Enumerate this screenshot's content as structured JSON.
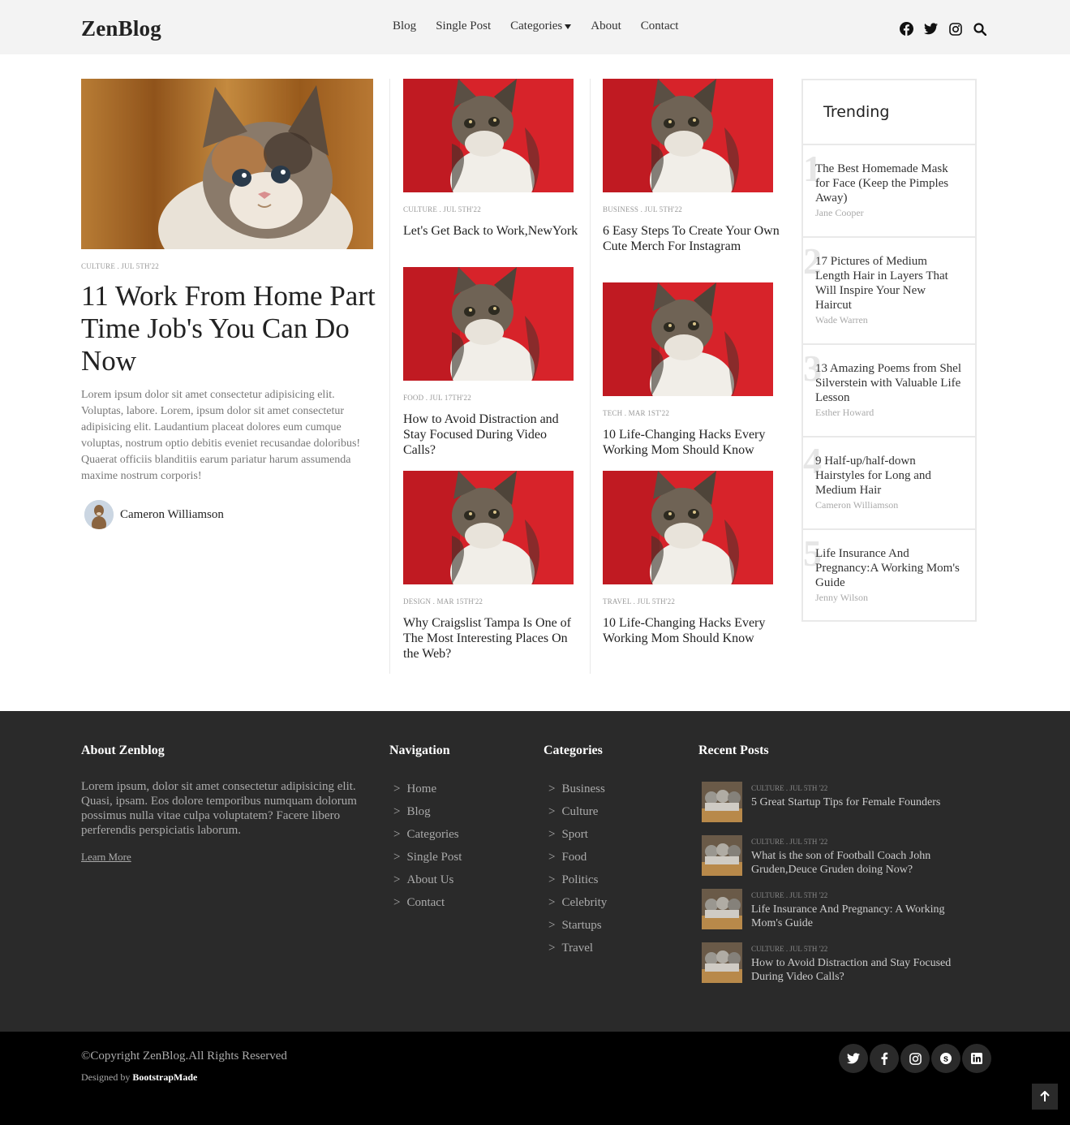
{
  "header": {
    "logo": "ZenBlog",
    "nav": [
      "Blog",
      "Single Post",
      "Categories",
      "About",
      "Contact"
    ]
  },
  "hero": {
    "meta": "Culture . Jul 5th'22",
    "title": "11 Work From Home Part Time Job's You Can Do Now",
    "excerpt": "Lorem ipsum dolor sit amet consectetur adipisicing elit. Voluptas, labore. Lorem, ipsum dolor sit amet consectetur adipisicing elit. Laudantium placeat dolores eum cumque voluptas, nostrum optio debitis eveniet recusandae doloribus! Quaerat officiis blanditiis earum pariatur harum assumenda maxime nostrum corporis!",
    "author": "Cameron Williamson"
  },
  "posts": {
    "p1": {
      "meta": "Culture . Jul 5th'22",
      "title": "Let's Get Back to Work,NewYork"
    },
    "p2": {
      "meta": "Food . Jul 17th'22",
      "title": "How to Avoid Distraction and Stay Focused During Video Calls?"
    },
    "p3": {
      "meta": "Design . Mar 15th'22",
      "title": "Why Craigslist Tampa Is One of The Most Interesting Places On the Web?"
    },
    "p4": {
      "meta": "Business . Jul 5th'22",
      "title": "6 Easy Steps To Create Your Own Cute Merch For Instagram"
    },
    "p5": {
      "meta": "Tech . Mar 1st'22",
      "title": "10 Life-Changing Hacks Every Working Mom Should Know"
    },
    "p6": {
      "meta": "Travel . Jul 5th'22",
      "title": "10 Life-Changing Hacks Every Working Mom Should Know"
    }
  },
  "trending": {
    "heading": "Trending",
    "items": [
      {
        "num": "1",
        "title": "The Best Homemade Mask for Face (Keep the Pimples Away)",
        "author": "Jane Cooper"
      },
      {
        "num": "2",
        "title": "17 Pictures of Medium Length Hair in Layers That Will Inspire Your New Haircut",
        "author": "Wade Warren"
      },
      {
        "num": "3",
        "title": "13 Amazing Poems from Shel Silverstein with Valuable Life Lesson",
        "author": "Esther Howard"
      },
      {
        "num": "4",
        "title": "9 Half-up/half-down Hairstyles for Long and Medium Hair",
        "author": "Cameron Williamson"
      },
      {
        "num": "5",
        "title": "Life Insurance And Pregnancy:A Working Mom's Guide",
        "author": "Jenny Wilson"
      }
    ]
  },
  "footer": {
    "about_heading": "About Zenblog",
    "about_text": "Lorem ipsum, dolor sit amet consectetur adipisicing elit. Quasi, ipsam. Eos dolore temporibus numquam dolorum possimus nulla vitae culpa voluptatem? Facere libero perferendis perspiciatis laborum.",
    "learn_more": "Learn More",
    "nav_heading": "Navigation",
    "nav_links": [
      "Home",
      "Blog",
      "Categories",
      "Single Post",
      "About Us",
      "Contact"
    ],
    "cat_heading": "Categories",
    "cat_links": [
      "Business",
      "Culture",
      "Sport",
      "Food",
      "Politics",
      "Celebrity",
      "Startups",
      "Travel"
    ],
    "recent_heading": "Recent Posts",
    "recent": [
      {
        "meta": "Culture . Jul 5th '22",
        "title": "5 Great Startup Tips for Female Founders"
      },
      {
        "meta": "Culture . Jul 5th '22",
        "title": "What is the son of Football Coach John Gruden,Deuce Gruden doing Now?"
      },
      {
        "meta": "Culture . Jul 5th '22",
        "title": "Life Insurance And Pregnancy: A Working Mom's Guide"
      },
      {
        "meta": "Culture . Jul 5th '22",
        "title": "How to Avoid Distraction and Stay Focused During Video Calls?"
      }
    ],
    "copyright": "©Copyright ZenBlog.All Rights Reserved",
    "designed_prefix": "Designed by",
    "designed_by": "BootstrapMade"
  }
}
